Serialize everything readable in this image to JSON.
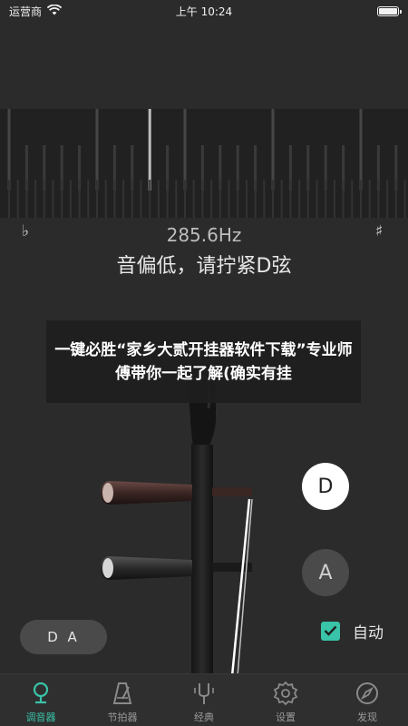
{
  "status_bar": {
    "carrier": "运营商",
    "time": "上午 10:24",
    "battery_level": 1.0
  },
  "tuner": {
    "flat_symbol": "♭",
    "sharp_symbol": "♯",
    "frequency": "285.6Hz",
    "hint": "音偏低，请拧紧D弦"
  },
  "banner": {
    "text": "一键必胜“家乡大贰开挂器软件下载”专业师傅带你一起了解(确实有挂"
  },
  "strings": {
    "d_label": "D",
    "a_label": "A",
    "selected": "D"
  },
  "mode": {
    "label": "D A"
  },
  "auto": {
    "label": "自动",
    "checked": true
  },
  "tabs": [
    {
      "label": "调音器",
      "icon": "tuner-pin-icon",
      "active": true
    },
    {
      "label": "节拍器",
      "icon": "metronome-icon",
      "active": false
    },
    {
      "label": "经典",
      "icon": "tuning-fork-icon",
      "active": false
    },
    {
      "label": "设置",
      "icon": "gear-icon",
      "active": false
    },
    {
      "label": "发现",
      "icon": "compass-icon",
      "active": false
    }
  ],
  "colors": {
    "accent": "#39c3a8",
    "background": "#2b2b2b",
    "meter_background": "#212121"
  }
}
